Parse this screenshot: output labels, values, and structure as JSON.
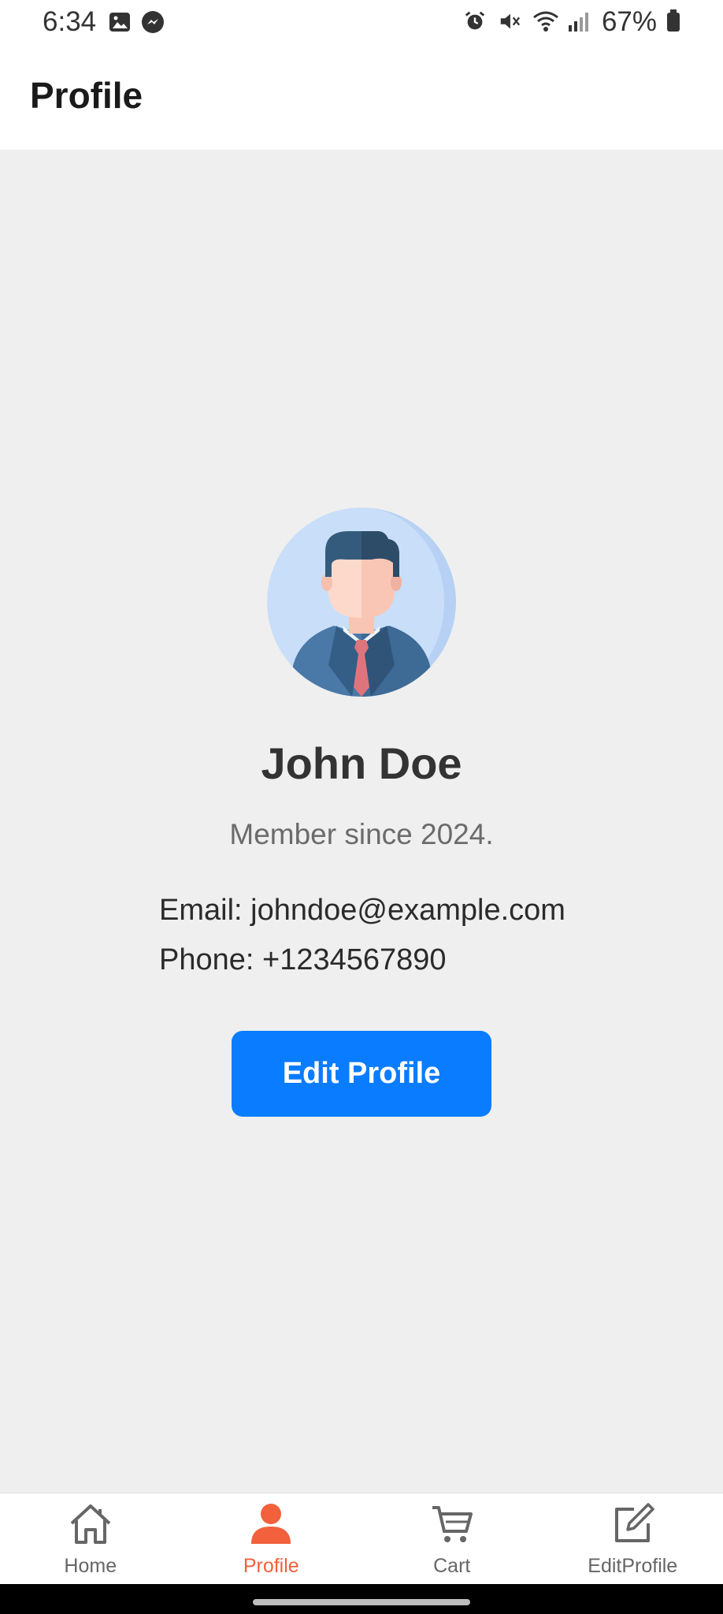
{
  "status_bar": {
    "time": "6:34",
    "battery_percent": "67%",
    "icons": [
      "image-icon",
      "messenger-icon",
      "alarm-icon",
      "mute-icon",
      "wifi-icon",
      "signal-icon",
      "battery-icon"
    ]
  },
  "header": {
    "title": "Profile"
  },
  "profile": {
    "name": "John Doe",
    "member_since": "Member since 2024.",
    "email": "Email: johndoe@example.com",
    "phone": "Phone: +1234567890",
    "edit_button_label": "Edit Profile"
  },
  "bottom_nav": {
    "items": [
      {
        "label": "Home",
        "icon": "home-icon",
        "active": false
      },
      {
        "label": "Profile",
        "icon": "person-icon",
        "active": true
      },
      {
        "label": "Cart",
        "icon": "cart-icon",
        "active": false
      },
      {
        "label": "EditProfile",
        "icon": "edit-icon",
        "active": false
      }
    ]
  },
  "colors": {
    "accent": "#f2603c",
    "button": "#0a7cff",
    "background": "#efefef"
  }
}
